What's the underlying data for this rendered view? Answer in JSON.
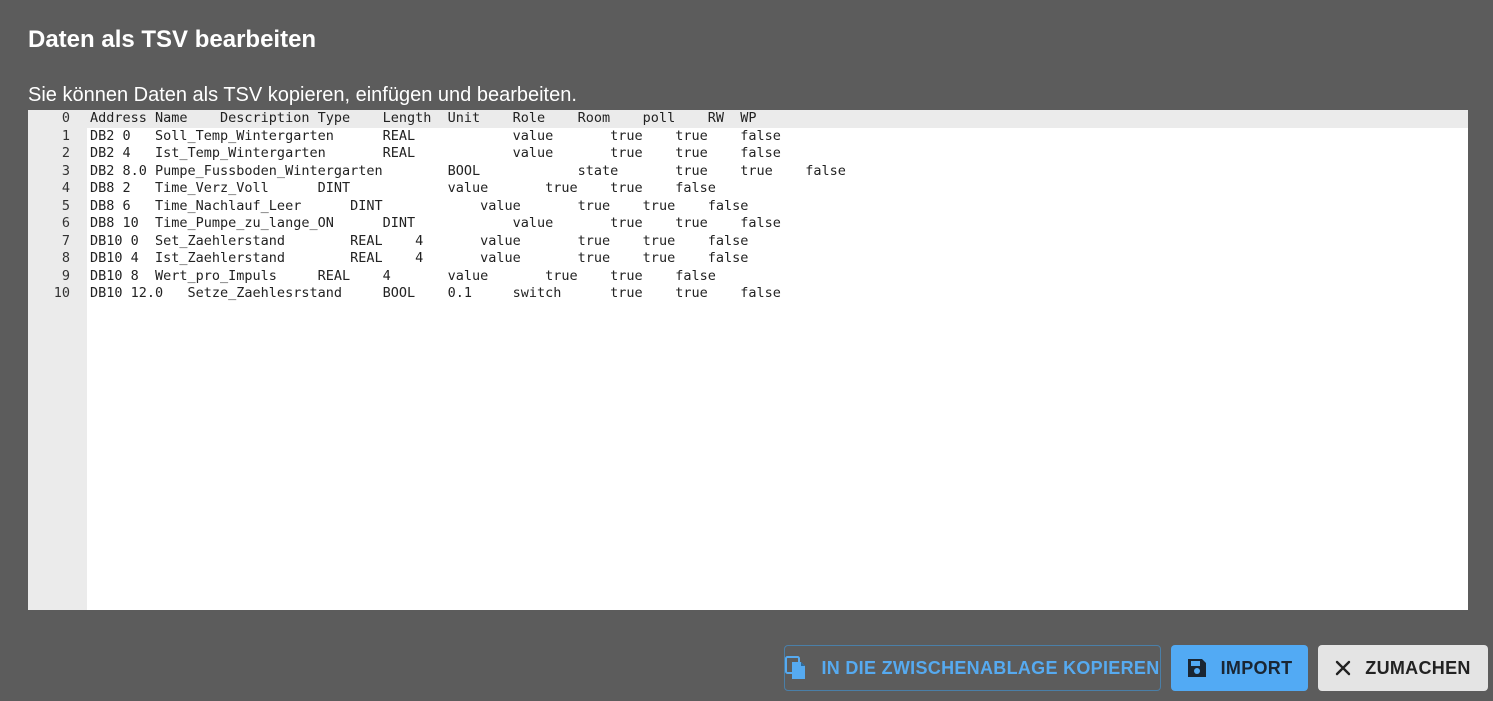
{
  "dialog": {
    "title": "Daten als TSV bearbeiten",
    "subtitle": "Sie können Daten als TSV kopieren, einfügen und bearbeiten."
  },
  "editor": {
    "lines": [
      {
        "num": "0",
        "text": "Address Name    Description Type    Length  Unit    Role    Room    poll    RW  WP"
      },
      {
        "num": "1",
        "text": "DB2 0   Soll_Temp_Wintergarten      REAL            value       true    true    false"
      },
      {
        "num": "2",
        "text": "DB2 4   Ist_Temp_Wintergarten       REAL            value       true    true    false"
      },
      {
        "num": "3",
        "text": "DB2 8.0 Pumpe_Fussboden_Wintergarten        BOOL            state       true    true    false"
      },
      {
        "num": "4",
        "text": "DB8 2   Time_Verz_Voll      DINT            value       true    true    false"
      },
      {
        "num": "5",
        "text": "DB8 6   Time_Nachlauf_Leer      DINT            value       true    true    false"
      },
      {
        "num": "6",
        "text": "DB8 10  Time_Pumpe_zu_lange_ON      DINT            value       true    true    false"
      },
      {
        "num": "7",
        "text": "DB10 0  Set_Zaehlerstand        REAL    4       value       true    true    false"
      },
      {
        "num": "8",
        "text": "DB10 4  Ist_Zaehlerstand        REAL    4       value       true    true    false"
      },
      {
        "num": "9",
        "text": "DB10 8  Wert_pro_Impuls     REAL    4       value       true    true    false"
      },
      {
        "num": "10",
        "text": "DB10 12.0   Setze_Zaehlesrstand     BOOL    0.1     switch      true    true    false"
      }
    ]
  },
  "buttons": {
    "copy_label": "IN DIE ZWISCHENABLAGE KOPIEREN",
    "copy_icon": "copy-icon",
    "import_label": "IMPORT",
    "import_icon": "save-icon",
    "close_label": "ZUMACHEN",
    "close_icon": "close-icon"
  },
  "colors": {
    "background": "#5c5c5c",
    "accent": "#52aaf4",
    "gutter": "#ebebeb"
  }
}
